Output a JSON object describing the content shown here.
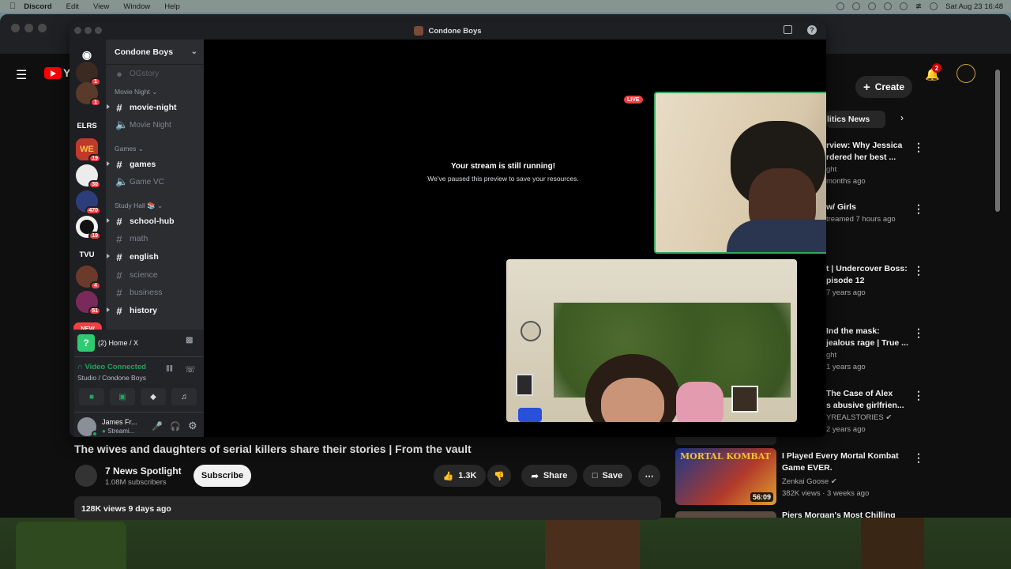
{
  "menubar": {
    "app": "Discord",
    "items": [
      "Edit",
      "View",
      "Window",
      "Help"
    ],
    "clock": "Sat Aug 23  16:48"
  },
  "youtube": {
    "logo_letter": "Y",
    "create_label": "Create",
    "notif_count": "2",
    "chip_label": "litics News",
    "recs": [
      {
        "l1": "rview: Why Jessica",
        "l2": "rdered her best ...",
        "sub1": "ght",
        "sub2": "months ago"
      },
      {
        "l1": "w/ Girls",
        "l2": "",
        "sub1": "treamed 7 hours ago",
        "sub2": ""
      },
      {
        "l1": "t | Undercover Boss:",
        "l2": "pisode 12",
        "sub1": "7 years ago",
        "sub2": ""
      },
      {
        "l1": "Ind the mask:",
        "l2": "jealous rage | True ...",
        "sub1": "ght",
        "sub2": "1 years ago"
      },
      {
        "l1": "The Case of Alex",
        "l2": "s abusive girlfrien...",
        "sub1": "YREALSTORIES",
        "sub2": "2 years ago"
      }
    ],
    "video_title": "The wives and daughters of serial killers share their stories | From the vault",
    "channel_name": "7 News Spotlight",
    "channel_subs": "1.08M subscribers",
    "subscribe_label": "Subscribe",
    "like_count": "1.3K",
    "share_label": "Share",
    "save_label": "Save",
    "views_line": "128K views  9 days ago",
    "mk_rec": {
      "title1": "I Played Every Mortal Kombat",
      "title2": "Game EVER.",
      "channel": "Zenkai Goose",
      "meta": "382K views · 3 weeks ago",
      "duration": "56:09",
      "thumb_text": "MORTAL KOMBAT"
    },
    "next_rec": "Piers Morgan's Most Chilling"
  },
  "discord": {
    "window_title": "Condone Boys",
    "server_name": "Condone Boys",
    "servers": [
      {
        "label": "",
        "badge": "1",
        "color": "#3b2a22"
      },
      {
        "label": "",
        "badge": "1",
        "color": "#5a3a2a"
      },
      {
        "label": "ELRS",
        "badge": "",
        "color": "#1e1f22"
      },
      {
        "label": "WE",
        "badge": "19",
        "color": "#c0392b"
      },
      {
        "label": "",
        "badge": "30",
        "color": "#ececec"
      },
      {
        "label": "",
        "badge": "470",
        "color": "#2c3e7a"
      },
      {
        "label": "",
        "badge": "19",
        "color": "#f2f2f2"
      },
      {
        "label": "TVU",
        "badge": "",
        "color": "#1e1f22"
      },
      {
        "label": "",
        "badge": "4",
        "color": "#6b3a2a"
      },
      {
        "label": "",
        "badge": "51",
        "color": "#7a2a5a"
      },
      {
        "label": "NEW",
        "badge": "",
        "color": "#f23f43"
      }
    ],
    "top_channel": "OGstory",
    "categories": {
      "movie": "Movie Night",
      "games": "Games",
      "study": "Study Hall 📚"
    },
    "channels": {
      "movie_night_text": "movie-night",
      "movie_night_voice": "Movie Night",
      "games_text": "games",
      "games_voice": "Game VC",
      "school_hub": "school-hub",
      "math": "math",
      "english": "english",
      "science": "science",
      "business": "business",
      "history": "history"
    },
    "activity": "(2) Home / X",
    "voice_status": "Video Connected",
    "voice_location": "Studio / Condone Boys",
    "user_name": "James Fr...",
    "user_status": "Streami...",
    "stream_paused_title": "Your stream is still running!",
    "stream_paused_sub": "We've paused this preview to save your resources.",
    "live_label": "LIVE"
  }
}
